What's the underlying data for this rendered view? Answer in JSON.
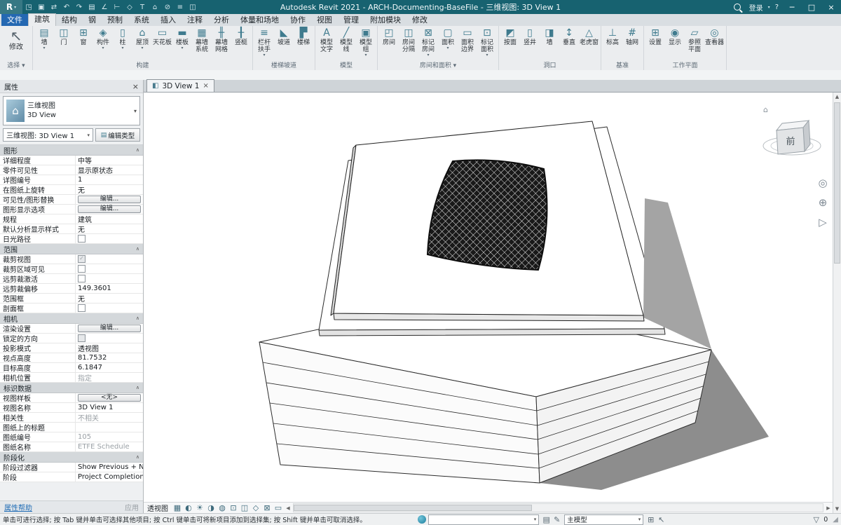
{
  "colors": {
    "titlebar": "#176270",
    "file_tab_blue": "#2468b2",
    "ribbon_icon_teal": "#3f7b8e",
    "link_blue": "#1f6cb5",
    "ground_shadow": "#8d8d8d"
  },
  "titlebar": {
    "logo": "R",
    "title": "Autodesk Revit 2021 - ARCH-Documenting-BaseFile - 三维视图: 3D View 1",
    "qat": [
      {
        "name": "open-icon",
        "glyph": "◳"
      },
      {
        "name": "save-icon",
        "glyph": "▣"
      },
      {
        "name": "sync-icon",
        "glyph": "⇄"
      },
      {
        "name": "undo-icon",
        "glyph": "↶"
      },
      {
        "name": "redo-icon",
        "glyph": "↷"
      },
      {
        "name": "print-icon",
        "glyph": "▤"
      },
      {
        "name": "measure-icon",
        "glyph": "∠"
      },
      {
        "name": "aligned-dimension-icon",
        "glyph": "⊢"
      },
      {
        "name": "tag-icon",
        "glyph": "◇"
      },
      {
        "name": "text-icon",
        "glyph": "T"
      },
      {
        "name": "default-3d-view-icon",
        "glyph": "⌂"
      },
      {
        "name": "section-icon",
        "glyph": "⊘"
      },
      {
        "name": "thin-lines-icon",
        "glyph": "≡"
      },
      {
        "name": "switch-windows-icon",
        "glyph": "◫"
      }
    ],
    "signin": "登录",
    "help": "?",
    "win": {
      "min": "─",
      "max": "□",
      "close": "×"
    }
  },
  "menu_tabs": [
    {
      "name": "tab-file",
      "label": "文件",
      "file": true
    },
    {
      "name": "tab-architecture",
      "label": "建筑",
      "active": true
    },
    {
      "name": "tab-structure",
      "label": "结构"
    },
    {
      "name": "tab-steel",
      "label": "钢"
    },
    {
      "name": "tab-precast",
      "label": "预制"
    },
    {
      "name": "tab-systems",
      "label": "系统"
    },
    {
      "name": "tab-insert",
      "label": "插入"
    },
    {
      "name": "tab-annotate",
      "label": "注释"
    },
    {
      "name": "tab-analyze",
      "label": "分析"
    },
    {
      "name": "tab-massing-site",
      "label": "体量和场地"
    },
    {
      "name": "tab-collaborate",
      "label": "协作"
    },
    {
      "name": "tab-view",
      "label": "视图"
    },
    {
      "name": "tab-manage",
      "label": "管理"
    },
    {
      "name": "tab-addins",
      "label": "附加模块"
    },
    {
      "name": "tab-modify",
      "label": "修改"
    }
  ],
  "ribbon": {
    "panels": [
      {
        "name": "select",
        "label": "选择",
        "caret": true,
        "buttons": [
          {
            "name": "modify-button",
            "label": "修改",
            "icon": "↖",
            "big": true
          }
        ]
      },
      {
        "name": "build",
        "label": "构建",
        "buttons": [
          {
            "name": "wall-button",
            "label": "墙",
            "icon": "▤",
            "caret": true
          },
          {
            "name": "door-button",
            "label": "门",
            "icon": "◫"
          },
          {
            "name": "window-button",
            "label": "窗",
            "icon": "⊞"
          },
          {
            "name": "component-button",
            "label": "构件",
            "icon": "◈",
            "caret": true
          },
          {
            "name": "column-button",
            "label": "柱",
            "icon": "▯",
            "caret": true
          },
          {
            "name": "roof-button",
            "label": "屋顶",
            "icon": "⌂",
            "caret": true
          },
          {
            "name": "ceiling-button",
            "label": "天花板",
            "icon": "▭"
          },
          {
            "name": "floor-button",
            "label": "楼板",
            "icon": "▬",
            "caret": true
          },
          {
            "name": "curtain-system-button",
            "label": "幕墙\n系统",
            "icon": "▦"
          },
          {
            "name": "curtain-grid-button",
            "label": "幕墙\n网格",
            "icon": "╫"
          },
          {
            "name": "mullion-button",
            "label": "竖梃",
            "icon": "╂"
          }
        ]
      },
      {
        "name": "circulation",
        "label": "楼梯坡道",
        "buttons": [
          {
            "name": "railing-button",
            "label": "栏杆\n扶手",
            "icon": "≡",
            "caret": true
          },
          {
            "name": "ramp-button",
            "label": "坡道",
            "icon": "◣"
          },
          {
            "name": "stair-button",
            "label": "楼梯",
            "icon": "▛"
          }
        ]
      },
      {
        "name": "model",
        "label": "模型",
        "buttons": [
          {
            "name": "model-text-button",
            "label": "模型\n文字",
            "icon": "A"
          },
          {
            "name": "model-line-button",
            "label": "模型\n线",
            "icon": "╱"
          },
          {
            "name": "model-group-button",
            "label": "模型\n组",
            "icon": "▣",
            "caret": true
          }
        ]
      },
      {
        "name": "room-area",
        "label": "房间和面积",
        "caret": true,
        "buttons": [
          {
            "name": "room-button",
            "label": "房间",
            "icon": "◰"
          },
          {
            "name": "room-separator-button",
            "label": "房间\n分隔",
            "icon": "◫"
          },
          {
            "name": "tag-room-button",
            "label": "标记\n房间",
            "icon": "⊠",
            "caret": true
          },
          {
            "name": "area-button",
            "label": "面积",
            "icon": "▢",
            "caret": true
          },
          {
            "name": "area-boundary-button",
            "label": "面积\n边界",
            "icon": "▭"
          },
          {
            "name": "tag-area-button",
            "label": "标记\n面积",
            "icon": "⊡",
            "caret": true
          }
        ]
      },
      {
        "name": "opening",
        "label": "洞口",
        "buttons": [
          {
            "name": "opening-by-face-button",
            "label": "按面",
            "icon": "◩"
          },
          {
            "name": "shaft-button",
            "label": "竖井",
            "icon": "▯"
          },
          {
            "name": "wall-opening-button",
            "label": "墙",
            "icon": "◨"
          },
          {
            "name": "vertical-opening-button",
            "label": "垂直",
            "icon": "↕"
          },
          {
            "name": "dormer-button",
            "label": "老虎窗",
            "icon": "△"
          }
        ]
      },
      {
        "name": "datum",
        "label": "基准",
        "buttons": [
          {
            "name": "level-button",
            "label": "标高",
            "icon": "⊥"
          },
          {
            "name": "grid-button",
            "label": "轴网",
            "icon": "#"
          }
        ]
      },
      {
        "name": "work-plane",
        "label": "工作平面",
        "buttons": [
          {
            "name": "set-work-plane-button",
            "label": "设置",
            "icon": "⊞"
          },
          {
            "name": "show-work-plane-button",
            "label": "显示",
            "icon": "◉"
          },
          {
            "name": "ref-plane-button",
            "label": "参照\n平面",
            "icon": "▱"
          },
          {
            "name": "viewer-button",
            "label": "查看器",
            "icon": "◎"
          }
        ]
      }
    ]
  },
  "properties": {
    "header": "属性",
    "type_selector": {
      "line1": "三维视图",
      "line2": "3D View"
    },
    "instance_selector": "三维视图: 3D View 1",
    "edit_type": "编辑类型",
    "sections": [
      {
        "title": "图形",
        "rows": [
          {
            "label": "详细程度",
            "value": "中等"
          },
          {
            "label": "零件可见性",
            "value": "显示原状态"
          },
          {
            "label": "详图编号",
            "value": "1"
          },
          {
            "label": "在图纸上旋转",
            "value": "无"
          },
          {
            "label": "可见性/图形替换",
            "value": "编辑...",
            "type": "button"
          },
          {
            "label": "图形显示选项",
            "value": "编辑...",
            "type": "button"
          },
          {
            "label": "规程",
            "value": "建筑"
          },
          {
            "label": "默认分析显示样式",
            "value": "无"
          },
          {
            "label": "日光路径",
            "type": "checkbox",
            "checked": false
          }
        ]
      },
      {
        "title": "范围",
        "rows": [
          {
            "label": "裁剪视图",
            "type": "checkbox",
            "checked": true,
            "disabled": true
          },
          {
            "label": "裁剪区域可见",
            "type": "checkbox",
            "checked": false
          },
          {
            "label": "远剪裁激活",
            "type": "checkbox",
            "checked": false
          },
          {
            "label": "远剪裁偏移",
            "value": "149.3601"
          },
          {
            "label": "范围框",
            "value": "无"
          },
          {
            "label": "剖面框",
            "type": "checkbox",
            "checked": false
          }
        ]
      },
      {
        "title": "相机",
        "rows": [
          {
            "label": "渲染设置",
            "value": "编辑...",
            "type": "button"
          },
          {
            "label": "锁定的方向",
            "type": "checkbox",
            "checked": false,
            "disabled": true
          },
          {
            "label": "投影模式",
            "value": "透视图"
          },
          {
            "label": "视点高度",
            "value": "81.7532"
          },
          {
            "label": "目标高度",
            "value": "6.1847"
          },
          {
            "label": "相机位置",
            "value": "指定",
            "disabled": true
          }
        ]
      },
      {
        "title": "标识数据",
        "rows": [
          {
            "label": "视图样板",
            "value": "<无>",
            "type": "button"
          },
          {
            "label": "视图名称",
            "value": "3D View 1"
          },
          {
            "label": "相关性",
            "value": "不相关",
            "disabled": true
          },
          {
            "label": "图纸上的标题",
            "value": "",
            "disabled": true
          },
          {
            "label": "图纸编号",
            "value": "105",
            "disabled": true
          },
          {
            "label": "图纸名称",
            "value": "ETFE Schedule",
            "disabled": true
          }
        ]
      },
      {
        "title": "阶段化",
        "rows": [
          {
            "label": "阶段过滤器",
            "value": "Show Previous + New"
          },
          {
            "label": "阶段",
            "value": "Project Completion"
          }
        ]
      }
    ],
    "footer": {
      "help": "属性帮助",
      "apply": "应用"
    }
  },
  "doc_tab": {
    "label": "3D View 1",
    "close": "×"
  },
  "canvas": {
    "viewcube_front": "前",
    "viewcube_home": "⌂"
  },
  "navbar": {
    "icons": [
      {
        "name": "steering-wheel-icon",
        "glyph": "◎"
      },
      {
        "name": "zoom-icon",
        "glyph": "⊕"
      },
      {
        "name": "orbit-icon",
        "glyph": "▷"
      }
    ]
  },
  "viewbar": {
    "mode": "透视图",
    "icons": [
      {
        "name": "detail-level-icon",
        "glyph": "▦"
      },
      {
        "name": "visual-style-icon",
        "glyph": "◐"
      },
      {
        "name": "sun-path-icon",
        "glyph": "☀"
      },
      {
        "name": "shadows-icon",
        "glyph": "◑"
      },
      {
        "name": "rendering-dialog-icon",
        "glyph": "◍"
      },
      {
        "name": "crop-view-icon",
        "glyph": "⊡"
      },
      {
        "name": "crop-region-icon",
        "glyph": "◫"
      },
      {
        "name": "temporary-hide-isolate-icon",
        "glyph": "◇"
      },
      {
        "name": "reveal-hidden-elements-icon",
        "glyph": "⊠"
      },
      {
        "name": "temporary-view-properties-icon",
        "glyph": "▭"
      }
    ]
  },
  "statusbar": {
    "hint": "单击可进行选择; 按 Tab 键并单击可选择其他项目; 按 Ctrl 键单击可将新项目添加到选择集; 按 Shift 键并单击可取消选择。",
    "design_option": "主模型",
    "selection_count": "0",
    "mid_icons": [
      {
        "name": "worksets-icon",
        "glyph": "▤"
      },
      {
        "name": "editing-requests-icon",
        "glyph": "✎"
      }
    ],
    "right_icons": [
      {
        "name": "exclude-options-icon",
        "glyph": "⊞"
      },
      {
        "name": "press-drag-icon",
        "glyph": "↖"
      }
    ]
  }
}
